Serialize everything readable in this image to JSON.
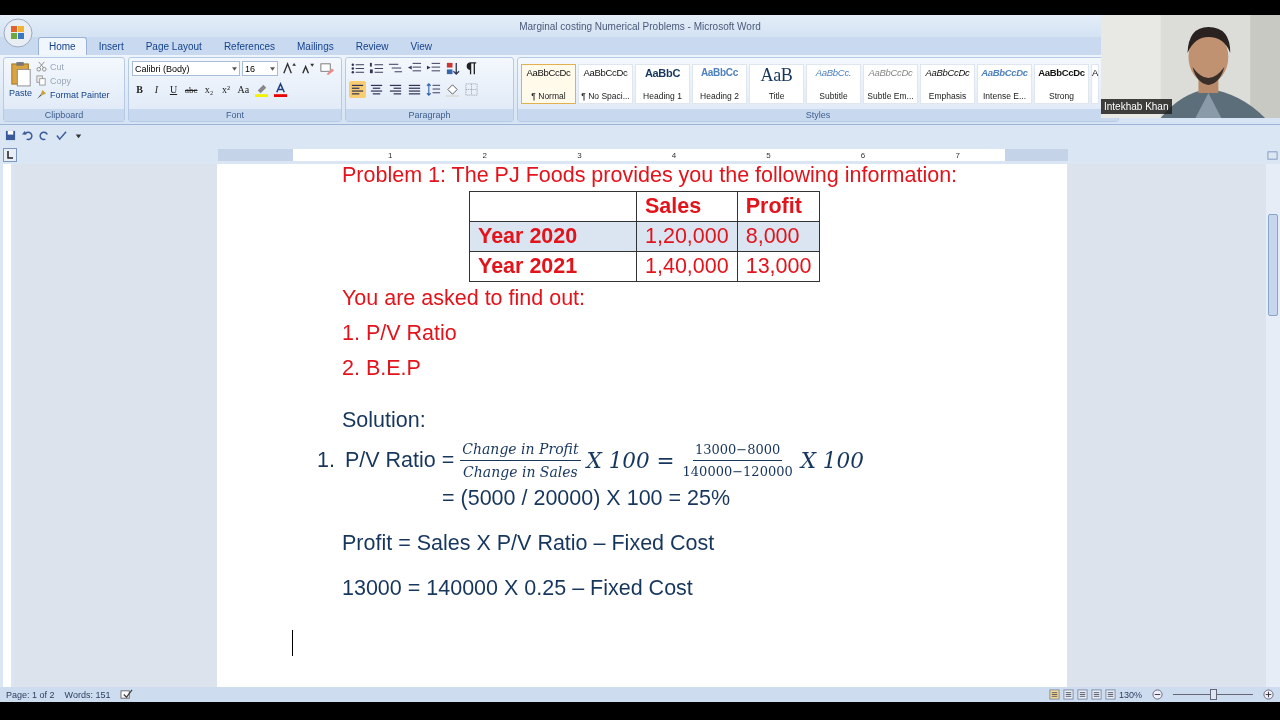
{
  "window": {
    "title": "Marginal costing Numerical Problems - Microsoft Word"
  },
  "tabs": [
    {
      "label": "Home",
      "selected": true
    },
    {
      "label": "Insert",
      "selected": false
    },
    {
      "label": "Page Layout",
      "selected": false
    },
    {
      "label": "References",
      "selected": false
    },
    {
      "label": "Mailings",
      "selected": false
    },
    {
      "label": "Review",
      "selected": false
    },
    {
      "label": "View",
      "selected": false
    }
  ],
  "clipboard": {
    "label": "Clipboard",
    "paste": "Paste",
    "items": [
      {
        "kind": "cut",
        "label": "Cut",
        "disabled": true
      },
      {
        "kind": "copy",
        "label": "Copy",
        "disabled": true
      },
      {
        "kind": "painter",
        "label": "Format Painter",
        "disabled": false
      }
    ]
  },
  "font": {
    "label": "Font",
    "name": "Calibri (Body)",
    "size": "16",
    "format_buttons": [
      {
        "label": "B",
        "kind": "bold"
      },
      {
        "label": "I",
        "kind": "italic"
      },
      {
        "label": "U",
        "kind": "underline"
      },
      {
        "label": "abc",
        "kind": "strike"
      },
      {
        "label": "x₂",
        "kind": "sub"
      },
      {
        "label": "x²",
        "kind": "sup"
      },
      {
        "label": "Aa",
        "kind": "case"
      }
    ]
  },
  "paragraph": {
    "label": "Paragraph",
    "alignment": [
      {
        "selected": true
      },
      {
        "selected": false
      },
      {
        "selected": false
      },
      {
        "selected": false
      }
    ]
  },
  "styles": {
    "label": "Styles",
    "items": [
      {
        "preview": "AaBbCcDc",
        "name": "¶ Normal",
        "kind": "normal",
        "selected": true
      },
      {
        "preview": "AaBbCcDc",
        "name": "¶ No Spaci...",
        "kind": "normal",
        "selected": false
      },
      {
        "preview": "AaBbC",
        "name": "Heading 1",
        "kind": "heading",
        "selected": false
      },
      {
        "preview": "AaBbCc",
        "name": "Heading 2",
        "kind": "heading2",
        "selected": false
      },
      {
        "preview": "AaB",
        "name": "Title",
        "kind": "title",
        "selected": false
      },
      {
        "preview": "AaBbCc.",
        "name": "Subtitle",
        "kind": "subtitle",
        "selected": false
      },
      {
        "preview": "AaBbCcDc",
        "name": "Subtle Em...",
        "kind": "subtle",
        "selected": false
      },
      {
        "preview": "AaBbCcDc",
        "name": "Emphasis",
        "kind": "emphasis",
        "selected": false
      },
      {
        "preview": "AaBbCcDc",
        "name": "Intense E...",
        "kind": "intense",
        "selected": false
      },
      {
        "preview": "AaBbCcDc",
        "name": "Strong",
        "kind": "strong",
        "selected": false
      },
      {
        "preview": "A",
        "kind": "normal",
        "selected": false
      }
    ]
  },
  "webcam": {
    "kind": "picture",
    "name": "Intekhab Khan"
  },
  "ruler": {
    "numbers": [
      "1",
      "2",
      "3",
      "4",
      "5",
      "6",
      "7"
    ]
  },
  "document": {
    "heading": "Problem 1: The PJ Foods provides you the following information:",
    "table": {
      "columns": [
        "Sales",
        "Profit"
      ],
      "rows": [
        {
          "label": "Year 2020",
          "cells": [
            "1,20,000",
            "8,000"
          ],
          "shaded": true
        },
        {
          "label": "Year 2021",
          "cells": [
            "1,40,000",
            "13,000"
          ],
          "shaded": false
        }
      ]
    },
    "task": "You are asked to find out:",
    "items": [
      "1. P/V Ratio",
      "2. B.E.P"
    ],
    "solution_title": "Solution:",
    "formula": {
      "number": "1.",
      "lhs": "P/V Ratio =",
      "frac1": {
        "num": "Change in Profit",
        "den": "Change in Sales"
      },
      "mid": "X 100 =",
      "frac2": {
        "num": "13000−8000",
        "den": "140000−120000"
      },
      "end": "X 100"
    },
    "lines": [
      "= (5000 / 20000) X 100 = 25%",
      "Profit = Sales X P/V Ratio – Fixed Cost",
      "13000 = 140000 X 0.25 – Fixed Cost"
    ]
  },
  "status_bar": {
    "page": "Page: 1 of 2",
    "words": "Words: 151",
    "zoom": "130%",
    "zoom_slider": {
      "level": 0.5
    }
  }
}
